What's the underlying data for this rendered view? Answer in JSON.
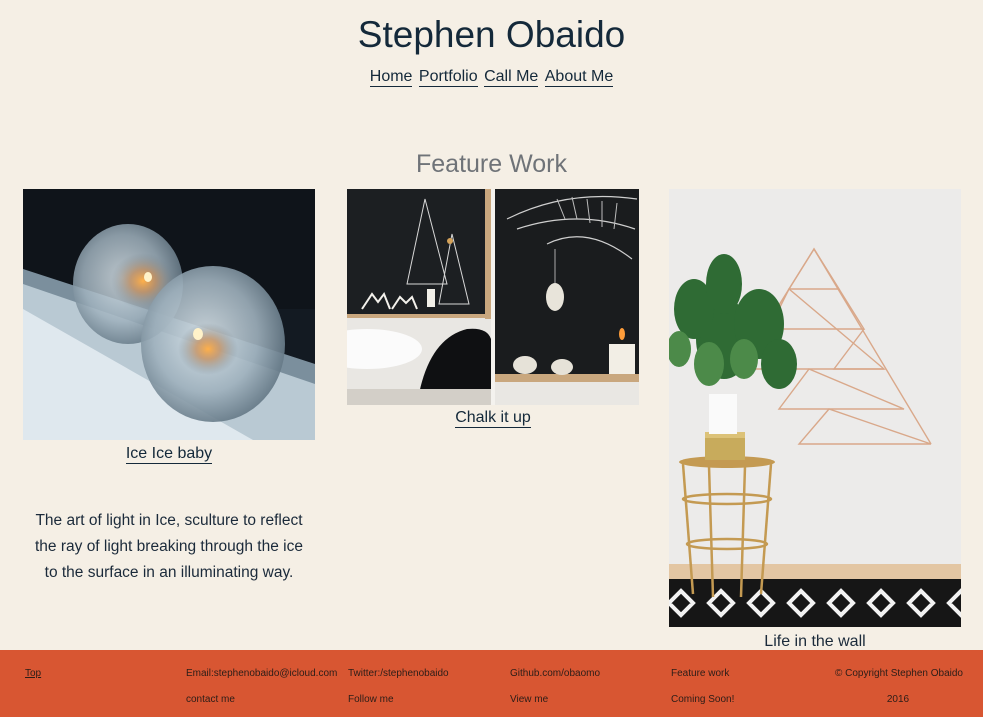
{
  "site": {
    "title": "Stephen Obaido"
  },
  "nav": {
    "items": [
      "Home",
      "Portfolio",
      "Call Me",
      "About Me"
    ]
  },
  "feature": {
    "title": "Feature Work",
    "cards": [
      {
        "caption": "Ice Ice baby",
        "description": [
          "The art of light in Ice, sculture to reflect",
          "the ray of light breaking through the ice",
          "to the surface in an illuminating way."
        ]
      },
      {
        "caption": "Chalk it up"
      },
      {
        "caption": "Life in the wall"
      }
    ]
  },
  "footer": {
    "top_link": "Top",
    "columns": [
      {
        "line1": "Email:stephenobaido@icloud.com",
        "line2": "contact me"
      },
      {
        "line1": "Twitter:/stephenobaido",
        "line2": "Follow me"
      },
      {
        "line1": "Github.com/obaomo",
        "line2": "View me"
      },
      {
        "line1": "Feature work",
        "line2": "Coming Soon!"
      }
    ],
    "copyright_line1": "© Copyright Stephen Obaido",
    "copyright_line2": "2016"
  },
  "colors": {
    "background": "#f5efe5",
    "footer": "#d85632",
    "heading": "#14293a"
  }
}
